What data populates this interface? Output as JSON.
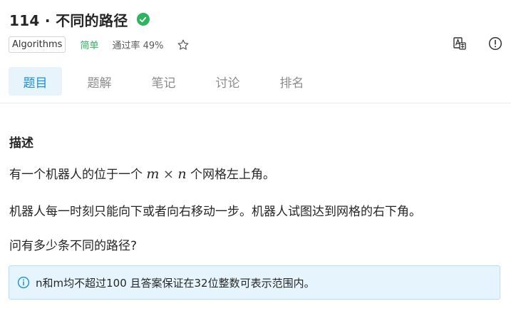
{
  "problem": {
    "title": "114 · 不同的路径",
    "category_tag": "Algorithms",
    "difficulty": "简单",
    "pass_rate": "通过率 49%"
  },
  "tabs": [
    {
      "label": "题目",
      "active": true
    },
    {
      "label": "题解",
      "active": false
    },
    {
      "label": "笔记",
      "active": false
    },
    {
      "label": "讨论",
      "active": false
    },
    {
      "label": "排名",
      "active": false
    }
  ],
  "description": {
    "heading": "描述",
    "line1_prefix": "有一个机器人的位于一个",
    "math_m": "m",
    "math_times": "×",
    "math_n": "n",
    "line1_suffix": "个网格左上角。",
    "line2": "机器人每一时刻只能向下或者向右移动一步。机器人试图达到网格的右下角。",
    "line3": "问有多少条不同的路径?"
  },
  "note": {
    "text": "n和m均不超过100 且答案保证在32位整数可表示范围内。"
  },
  "icons": {
    "solved": "check-circle-icon",
    "favorite": "star-icon",
    "translate": "translate-icon",
    "report": "info-circle-icon",
    "note": "info-circle-icon"
  },
  "colors": {
    "accent": "#1a90d9",
    "easy": "#2db55d",
    "note_bg": "#e6f5fd"
  }
}
